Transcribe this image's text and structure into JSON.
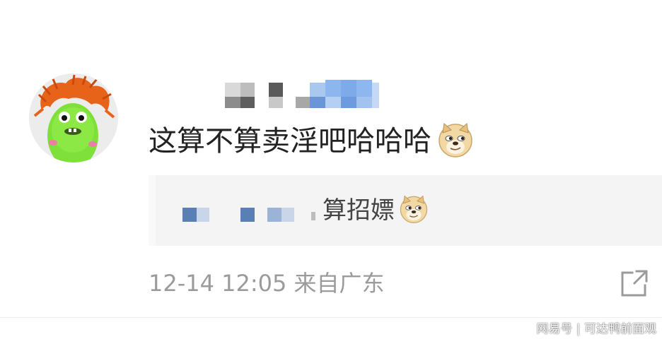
{
  "comment": {
    "avatar_icon": "orange-hair-green-monster-avatar",
    "username_blurred": true,
    "text": "这算不算卖淫吧哈哈哈",
    "emoji": "doge-emoji"
  },
  "reply": {
    "quoted_text": "算招嫖",
    "emoji": "doge-emoji",
    "author_blurred": true
  },
  "meta": {
    "timestamp": "12-14 12:05 来自广东",
    "share_icon": "share-external-icon"
  },
  "watermark": {
    "text": "网易号 | 可达鸭前面观"
  },
  "colors": {
    "primary_text": "#222222",
    "reply_bg": "#f4f4f4",
    "meta_text": "#9b9b9b",
    "blur_blue": "#5a7fb5"
  }
}
